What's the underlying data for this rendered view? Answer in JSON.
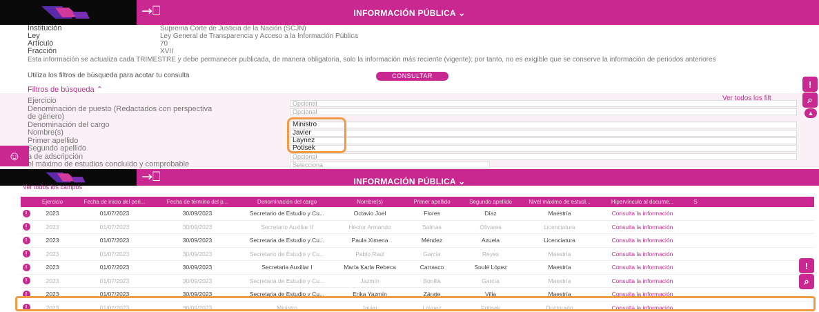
{
  "colors": {
    "brand": "#c8288f",
    "highlight": "#f39a45"
  },
  "header": {
    "title": "INFORMACIÓN PÚBLICA",
    "logo_icon": "portal-logo-icon",
    "exit_icon": "exit-icon",
    "chevron": "chevron-down-icon"
  },
  "info": {
    "rows": [
      {
        "key": "Institución",
        "value": "Suprema Corte de Justicia de la Nación (SCJN)"
      },
      {
        "key": "Ley",
        "value": "Ley General de Transparencia y Acceso a la Información Pública"
      },
      {
        "key": "Artículo",
        "value": "70"
      },
      {
        "key": "Fracción",
        "value": "XVII"
      }
    ],
    "description": "Esta información se actualiza cada TRIMESTRE y debe permanecer publicada, de manera obligatoria, solo la información más reciente (vigente); por tanto, no es exigible que se conserve la información de periodos anteriores",
    "filter_hint": "Utiliza los filtros de búsqueda para acotar tu consulta",
    "consultar": "CONSULTAR"
  },
  "filters": {
    "title": "Filtros de búsqueda",
    "ver_todos": "Ver todos los filt",
    "labels": [
      "Ejercicio",
      "Denominación de puesto (Redactados con perspectiva",
      "de género)",
      "Denominación del cargo",
      "Nombre(s)",
      "Primer apellido",
      "Segundo apellido",
      "a de adscripción",
      "el máximo de estudios concluido y comprobable"
    ],
    "fields": [
      "Opcional",
      "Opcional",
      "Ministro",
      "Javier",
      "Laynez",
      "Potisek",
      "Opcional",
      "Selecciona"
    ]
  },
  "table": {
    "ver_todos": "Ver todos los campos",
    "headers": [
      "Ejercicio",
      "Fecha de inicio del peri...",
      "Fecha de término del p...",
      "Denominación del cargo",
      "Nombre(s)",
      "Primer apellido",
      "Segundo apellido",
      "Nivel máximo de estudi...",
      "Hipervínculo al docume...",
      "S"
    ],
    "rows": [
      [
        "2023",
        "01/07/2023",
        "30/09/2023",
        "Secretario de Estudio y Cu...",
        "Octavio Joel",
        "Flores",
        "Díaz",
        "Maestría",
        "Consulta la información"
      ],
      [
        "2023",
        "01/07/2023",
        "30/09/2023",
        "Secretario Auxiliar II",
        "Héctor Armando",
        "Salinas",
        "Olivares",
        "Licenciatura",
        "Consulta la información"
      ],
      [
        "2023",
        "01/07/2023",
        "30/09/2023",
        "Secretaria de Estudio y Cu...",
        "Paula Ximena",
        "Méndez",
        "Azuela",
        "Licenciatura",
        "Consulta la información"
      ],
      [
        "2023",
        "01/07/2023",
        "30/09/2023",
        "Secretario de Estudio y Cu...",
        "Pablo Raúl",
        "García",
        "Reyes",
        "Maestría",
        "Consulta la información"
      ],
      [
        "2023",
        "01/07/2023",
        "30/09/2023",
        "Secretaria Auxiliar I",
        "María Karla Rebeca",
        "Carrasco",
        "Soulé López",
        "Maestría",
        "Consulta la información"
      ],
      [
        "2023",
        "01/07/2023",
        "30/09/2023",
        "Secretaria de Estudio y Cu...",
        "Jazmín",
        "Bonilla",
        "García",
        "Maestría",
        "Consulta la información"
      ],
      [
        "2023",
        "01/07/2023",
        "30/09/2023",
        "Secretaria de Estudio y Cu...",
        "Erika Yazmín",
        "Zárate",
        "Villa",
        "Maestría",
        "Consulta la información"
      ],
      [
        "2023",
        "01/07/2023",
        "30/09/2023",
        "Ministro",
        "Javier",
        "Laynez",
        "Potisek",
        "Doctorado",
        "Consulta la información"
      ]
    ]
  }
}
